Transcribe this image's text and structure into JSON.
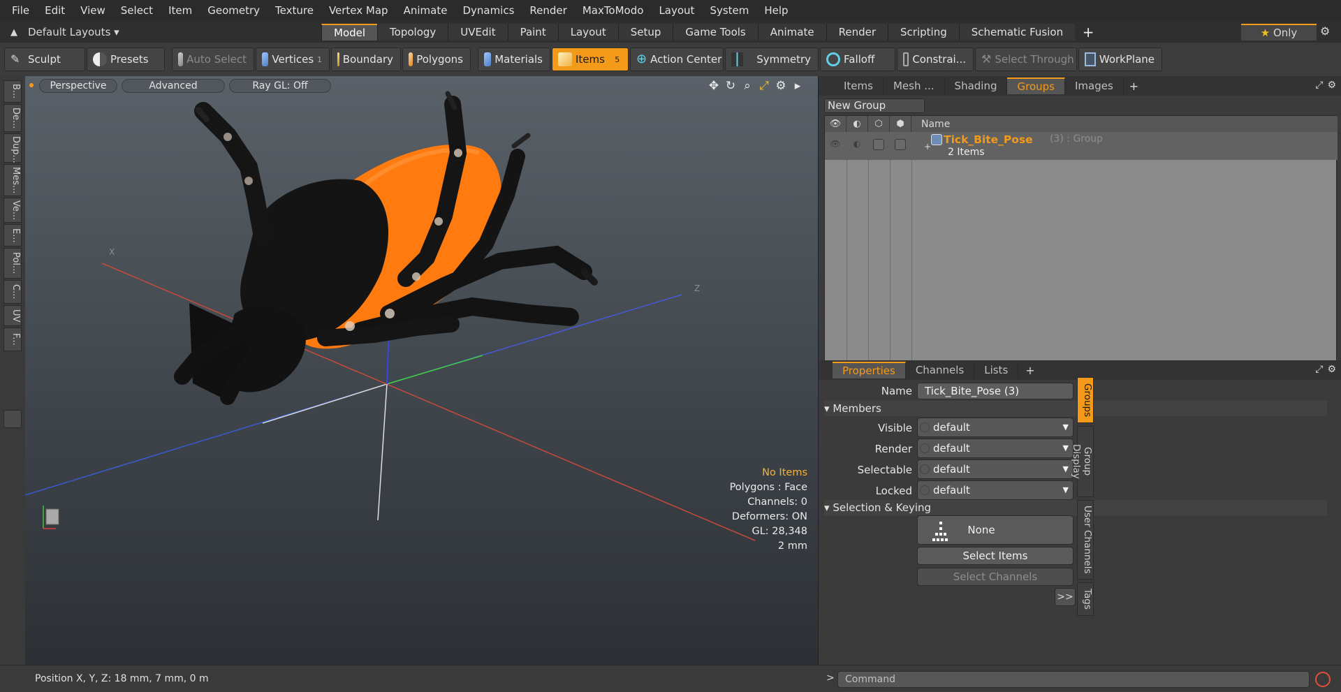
{
  "menu": [
    "File",
    "Edit",
    "View",
    "Select",
    "Item",
    "Geometry",
    "Texture",
    "Vertex Map",
    "Animate",
    "Dynamics",
    "Render",
    "MaxToModo",
    "Layout",
    "System",
    "Help"
  ],
  "layout_row": {
    "default_layouts": "Default Layouts ▾",
    "tabs": [
      "Model",
      "Topology",
      "UVEdit",
      "Paint",
      "Layout",
      "Setup",
      "Game Tools",
      "Animate",
      "Render",
      "Scripting",
      "Schematic Fusion"
    ],
    "active_tab": "Model",
    "plus": "+",
    "only_label": "Only"
  },
  "toolbar": {
    "sculpt": "Sculpt",
    "presets": "Presets",
    "auto_select": "Auto Select",
    "vertices": "Vertices",
    "vertices_count": "1",
    "boundary": "Boundary",
    "polygons": "Polygons",
    "materials": "Materials",
    "items": "Items",
    "items_count": "5",
    "action_center": "Action Center",
    "symmetry": "Symmetry",
    "falloff": "Falloff",
    "constraints": "Constrai...",
    "select_through": "Select Through",
    "workplane": "WorkPlane"
  },
  "left_tabs": [
    "B...",
    "De...",
    "Dup...",
    "Mes...",
    "Ve...",
    "E...",
    "Pol...",
    "C...",
    "UV",
    "F..."
  ],
  "viewport": {
    "perspective": "Perspective",
    "advanced": "Advanced",
    "raygl": "Ray GL: Off",
    "axis_label_x": "X",
    "axis_label_z": "Z",
    "info": {
      "no_items": "No Items",
      "polygons": "Polygons : Face",
      "channels": "Channels: 0",
      "deformers": "Deformers: ON",
      "gl": "GL: 28,348",
      "scale": "2 mm"
    }
  },
  "status": {
    "position": "Position X, Y, Z:   18 mm, 7 mm, 0 m"
  },
  "command": {
    "arrow": ">",
    "placeholder": "Command"
  },
  "groups_panel": {
    "tabs": [
      "Items",
      "Mesh ...",
      "Shading",
      "Groups",
      "Images"
    ],
    "active_tab": "Groups",
    "new_group": "New Group",
    "header_name": "Name",
    "row": {
      "name": "Tick_Bite_Pose",
      "meta": "(3) : Group",
      "sub": "2 Items"
    }
  },
  "properties": {
    "tabs": [
      "Properties",
      "Channels",
      "Lists"
    ],
    "active_tab": "Properties",
    "name_label": "Name",
    "name_value": "Tick_Bite_Pose (3)",
    "members_section": "Members",
    "visible_label": "Visible",
    "visible_value": "default",
    "render_label": "Render",
    "render_value": "default",
    "selectable_label": "Selectable",
    "selectable_value": "default",
    "locked_label": "Locked",
    "locked_value": "default",
    "sel_section": "Selection & Keying",
    "none_label": "None",
    "select_items": "Select Items",
    "select_channels": "Select Channels",
    "more": ">>"
  },
  "right_vtabs": [
    "Groups",
    "Group Display",
    "User Channels",
    "Tags"
  ],
  "colors": {
    "accent": "#f49a1a",
    "tick_body": "#ff7a0f",
    "tick_dark": "#141414",
    "viewport_top": "#5a6168",
    "viewport_bottom": "#2c3035"
  }
}
